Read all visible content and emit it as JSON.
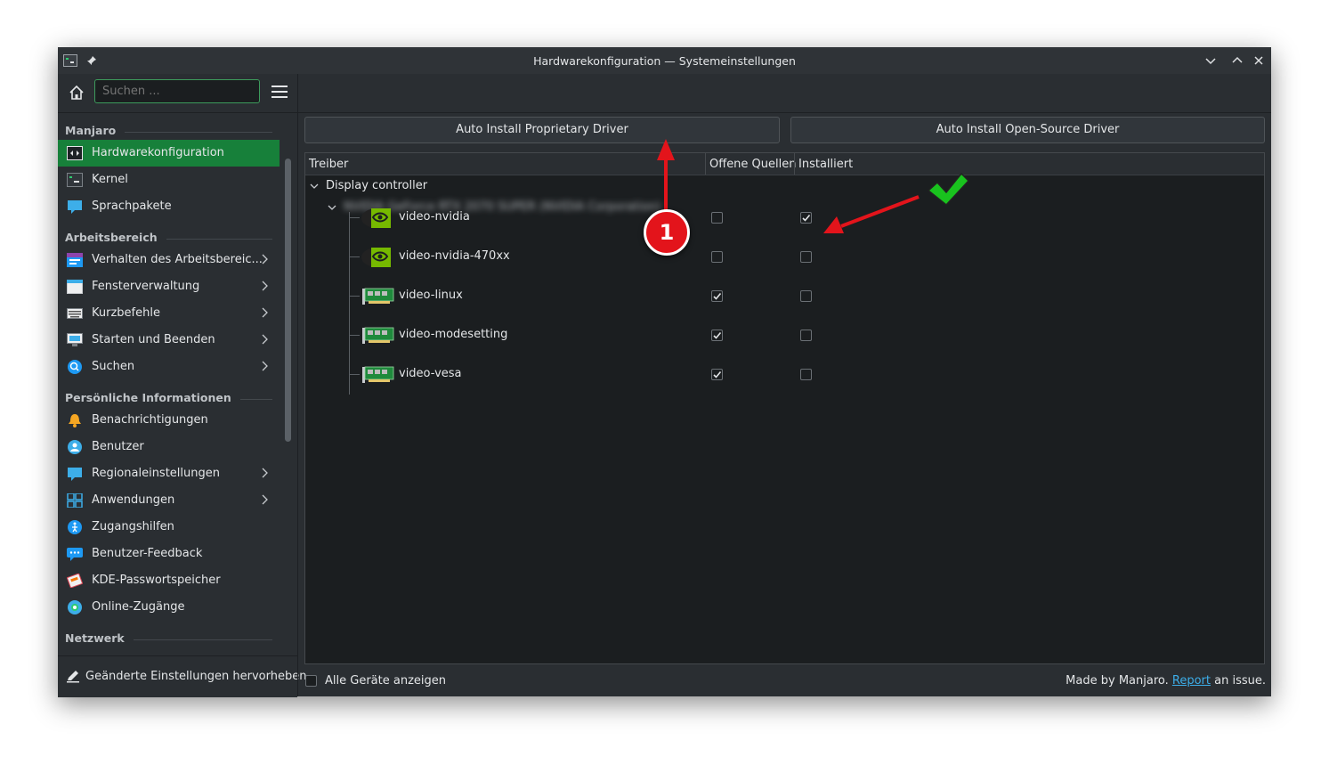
{
  "window": {
    "title": "Hardwarekonfiguration — Systemeinstellungen"
  },
  "search": {
    "placeholder": "Suchen ...",
    "value": ""
  },
  "sidebar": {
    "sections": [
      {
        "label": "Manjaro",
        "items": [
          {
            "label": "Hardwarekonfiguration",
            "icon": "hardware-icon",
            "active": true,
            "has_children": false
          },
          {
            "label": "Kernel",
            "icon": "kernel-icon",
            "active": false,
            "has_children": false
          },
          {
            "label": "Sprachpakete",
            "icon": "language-packs-icon",
            "active": false,
            "has_children": false
          }
        ]
      },
      {
        "label": "Arbeitsbereich",
        "items": [
          {
            "label": "Verhalten des Arbeitsbereic...",
            "icon": "workspace-behavior-icon",
            "has_children": true
          },
          {
            "label": "Fensterverwaltung",
            "icon": "window-management-icon",
            "has_children": true
          },
          {
            "label": "Kurzbefehle",
            "icon": "keyboard-shortcuts-icon",
            "has_children": true
          },
          {
            "label": "Starten und Beenden",
            "icon": "startup-shutdown-icon",
            "has_children": true
          },
          {
            "label": "Suchen",
            "icon": "search-icon",
            "has_children": true
          }
        ]
      },
      {
        "label": "Persönliche Informationen",
        "items": [
          {
            "label": "Benachrichtigungen",
            "icon": "notifications-bell-icon",
            "has_children": false
          },
          {
            "label": "Benutzer",
            "icon": "users-icon",
            "has_children": false
          },
          {
            "label": "Regionaleinstellungen",
            "icon": "regional-settings-icon",
            "has_children": true
          },
          {
            "label": "Anwendungen",
            "icon": "applications-grid-icon",
            "has_children": true
          },
          {
            "label": "Zugangshilfen",
            "icon": "accessibility-icon",
            "has_children": false
          },
          {
            "label": "Benutzer-Feedback",
            "icon": "feedback-icon",
            "has_children": false
          },
          {
            "label": "KDE-Passwortspeicher",
            "icon": "wallet-icon",
            "has_children": false
          },
          {
            "label": "Online-Zugänge",
            "icon": "online-accounts-icon",
            "has_children": false
          }
        ]
      },
      {
        "label": "Netzwerk",
        "items": []
      }
    ],
    "footer_label": "Geänderte Einstellungen hervorheben"
  },
  "actions": {
    "proprietary_label": "Auto Install Proprietary Driver",
    "opensource_label": "Auto Install Open-Source Driver"
  },
  "table": {
    "headers": [
      "Treiber",
      "Offene Quellen",
      "Installiert"
    ],
    "category": "Display controller",
    "device": "NVIDIA GeForce RTX 2070 SUPER (NVIDIA Corporation)",
    "drivers": [
      {
        "name": "video-nvidia",
        "icon": "nvidia-logo-icon",
        "open_source": false,
        "installed": true
      },
      {
        "name": "video-nvidia-470xx",
        "icon": "nvidia-logo-icon",
        "open_source": false,
        "installed": false
      },
      {
        "name": "video-linux",
        "icon": "graphics-card-icon",
        "open_source": true,
        "installed": false
      },
      {
        "name": "video-modesetting",
        "icon": "graphics-card-icon",
        "open_source": true,
        "installed": false
      },
      {
        "name": "video-vesa",
        "icon": "graphics-card-icon",
        "open_source": true,
        "installed": false
      }
    ]
  },
  "footer": {
    "show_all_label": "Alle Geräte anzeigen",
    "show_all_checked": false,
    "credit_prefix": "Made by Manjaro.",
    "report_link": "Report",
    "credit_suffix": "an issue."
  },
  "annotation": {
    "badge_number": "1",
    "colors": {
      "arrow": "#e3141b",
      "check": "#19c21e"
    }
  }
}
